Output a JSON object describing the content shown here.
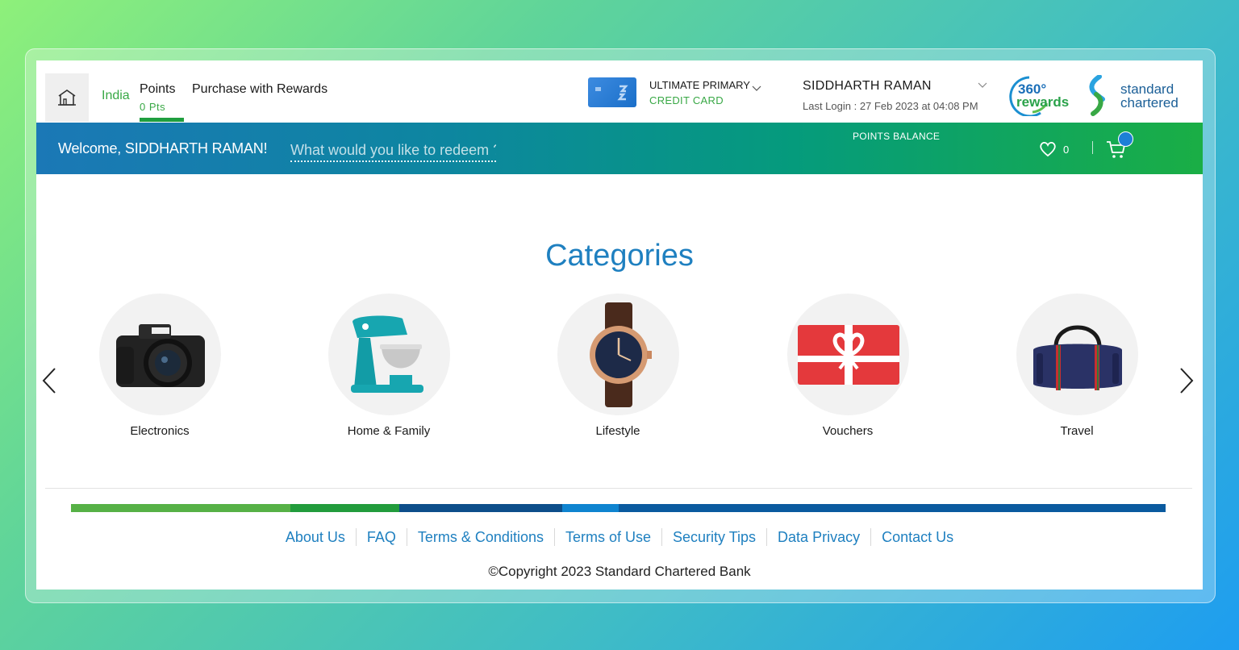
{
  "header": {
    "country": "India",
    "points_label": "Points",
    "points_value": "0 Pts",
    "purchase_label": "Purchase with Rewards",
    "card_type": "ULTIMATE PRIMARY",
    "card_subtitle": "CREDIT CARD",
    "user_name": "SIDDHARTH RAMAN",
    "last_login": "Last Login : 27 Feb 2023 at 04:08 PM",
    "rewards_logo_text": [
      "360°",
      "rewards"
    ],
    "bank_logo_text": [
      "standard",
      "chartered"
    ]
  },
  "banner": {
    "welcome": "Welcome, SIDDHARTH RAMAN!",
    "search_placeholder": "What would you like to redeem ?",
    "points_balance_label": "POINTS BALANCE",
    "wishlist_count": "0"
  },
  "categories": {
    "title": "Categories",
    "items": [
      {
        "label": "Electronics",
        "icon": "camera-icon"
      },
      {
        "label": "Home & Family",
        "icon": "stand-mixer-icon"
      },
      {
        "label": "Lifestyle",
        "icon": "wristwatch-icon"
      },
      {
        "label": "Vouchers",
        "icon": "gift-card-icon"
      },
      {
        "label": "Travel",
        "icon": "duffel-bag-icon"
      }
    ]
  },
  "footer": {
    "links": [
      "About Us",
      "FAQ",
      "Terms & Conditions",
      "Terms of Use",
      "Security Tips",
      "Data Privacy",
      "Contact Us"
    ],
    "copyright": "©Copyright 2023 Standard Chartered Bank"
  },
  "colors": {
    "brand_green": "#38a845",
    "brand_blue": "#1f80c0",
    "banner_start": "#1b78b6",
    "banner_end": "#1aae45"
  }
}
